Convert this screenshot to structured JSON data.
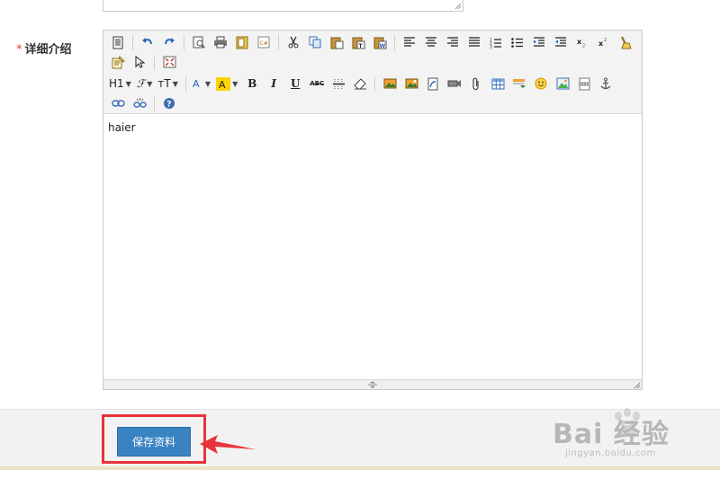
{
  "form": {
    "detail_label": "详细介绍",
    "required_mark": "*"
  },
  "editor": {
    "toolbar": {
      "row2_dropdowns": [
        "H1",
        "ℱ",
        "тT"
      ],
      "bold": "B",
      "italic": "I",
      "underline": "U",
      "strikethrough": "ABC"
    },
    "content": "haier"
  },
  "actions": {
    "save_label": "保存资料"
  },
  "watermark": {
    "brand": "Bai 经验",
    "url": "jingyan.baidu.com"
  },
  "colors": {
    "primary_button": "#3a83c3",
    "highlight": "#e8333a",
    "required": "#e4393c"
  }
}
